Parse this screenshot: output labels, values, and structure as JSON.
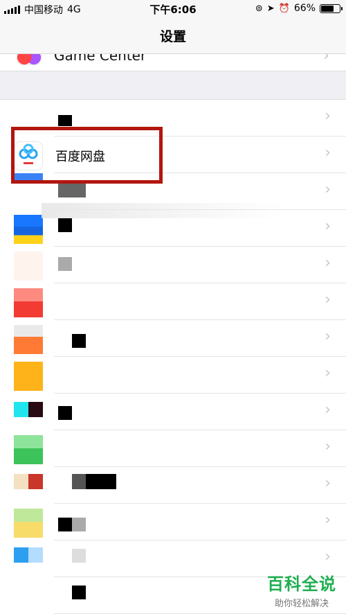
{
  "status_bar": {
    "carrier": "中国移动",
    "network": "4G",
    "time": "下午6:06",
    "battery_percent": "66%",
    "battery_level": 0.66
  },
  "nav": {
    "title": "设置"
  },
  "rows": {
    "game_center": {
      "label": "Game Center",
      "icon": "game-center-icon"
    },
    "baidu": {
      "label": "百度网盘",
      "icon": "baidu-netdisk-icon"
    }
  },
  "watermark": {
    "title": "百科全说",
    "subtitle": "助你轻松解决"
  },
  "colors": {
    "highlight": "#b2160f",
    "watermark": "#1fae4f",
    "chevron": "#c7c7cc"
  }
}
